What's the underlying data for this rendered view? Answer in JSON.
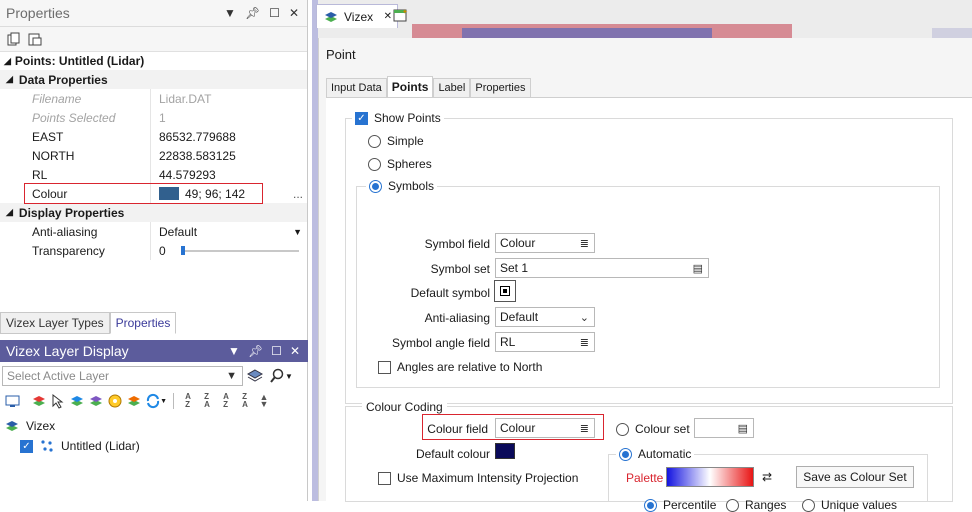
{
  "properties_panel": {
    "title": "Properties",
    "object_title": "Points: Untitled (Lidar)",
    "data_group": "Data Properties",
    "display_group": "Display Properties",
    "rows": {
      "filename_k": "Filename",
      "filename_v": "Lidar.DAT",
      "pointsel_k": "Points Selected",
      "pointsel_v": "1",
      "east_k": "EAST",
      "east_v": "86532.779688",
      "north_k": "NORTH",
      "north_v": "22838.583125",
      "rl_k": "RL",
      "rl_v": "44.579293",
      "colour_k": "Colour",
      "colour_v": "49; 96; 142",
      "colour_more": "...",
      "aa_k": "Anti-aliasing",
      "aa_v": "Default",
      "tr_k": "Transparency",
      "tr_v": "0"
    },
    "swatch_color": "#31608e",
    "transparency_level": 0
  },
  "bottom_tabs": {
    "layer_types": "Vizex Layer Types",
    "properties": "Properties"
  },
  "layer_display": {
    "title": "Vizex Layer Display",
    "select_placeholder": "Select Active Layer",
    "tree_root": "Vizex",
    "tree_child": "Untitled (Lidar)"
  },
  "vizex_tab": "Vizex",
  "dialog": {
    "title": "Point",
    "tabs": [
      "Input Data",
      "Points",
      "Label",
      "Properties"
    ],
    "show_points": "Show Points",
    "simple": "Simple",
    "spheres": "Spheres",
    "symbols": "Symbols",
    "symbol_field_lbl": "Symbol field",
    "symbol_field_val": "Colour",
    "symbol_set_lbl": "Symbol set",
    "symbol_set_val": "Set 1",
    "default_symbol_lbl": "Default symbol",
    "aa_lbl": "Anti-aliasing",
    "aa_val": "Default",
    "angle_lbl": "Symbol angle field",
    "angle_val": "RL",
    "angles_relative": "Angles are relative to North",
    "colour_coding": "Colour Coding",
    "colour_field_lbl": "Colour field",
    "colour_field_val": "Colour",
    "colour_set": "Colour set",
    "default_colour_lbl": "Default colour",
    "automatic": "Automatic",
    "mip": "Use Maximum Intensity Projection",
    "palette_lbl": "Palette",
    "save_btn": "Save as Colour Set",
    "percentile": "Percentile",
    "ranges": "Ranges",
    "unique": "Unique values"
  },
  "colors": {
    "accent": "#2773d1",
    "highlight": "#d9252f",
    "default_colour": "#0a0a5a",
    "title_bar": "#5c5c9c"
  }
}
